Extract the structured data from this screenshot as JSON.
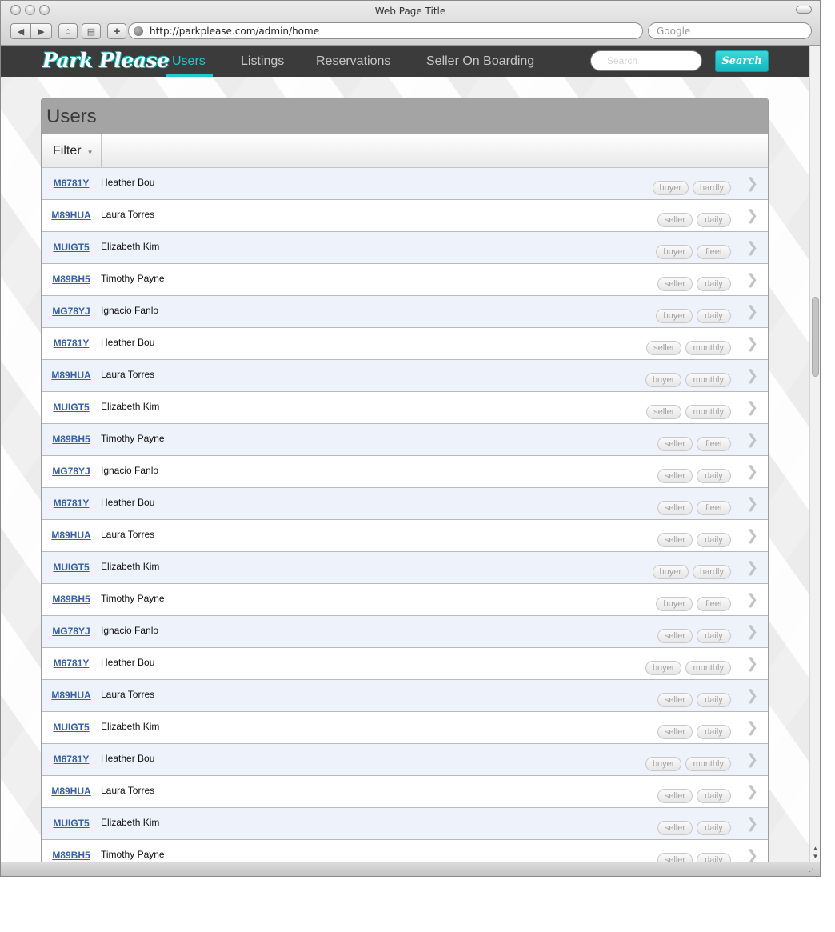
{
  "window": {
    "title": "Web Page Title"
  },
  "browser": {
    "url": "http://parkplease.com/admin/home",
    "search_placeholder": "Google"
  },
  "app": {
    "logo": "Park Please",
    "nav": [
      "Users",
      "Listings",
      "Reservations",
      "Seller On Boarding"
    ],
    "active_nav": "Users",
    "search_placeholder": "Search",
    "search_button": "Search"
  },
  "page": {
    "title": "Users",
    "filter_label": "Filter"
  },
  "users": [
    {
      "id": "M6781Y",
      "name": "Heather Bou",
      "role": "buyer",
      "plan": "hardly"
    },
    {
      "id": "M89HUA",
      "name": "Laura Torres",
      "role": "seller",
      "plan": "daily"
    },
    {
      "id": "MUIGT5",
      "name": "Elizabeth Kim",
      "role": "buyer",
      "plan": "fleet"
    },
    {
      "id": "M89BH5",
      "name": "Timothy Payne",
      "role": "seller",
      "plan": "daily"
    },
    {
      "id": "MG78YJ",
      "name": "Ignacio Fanlo",
      "role": "buyer",
      "plan": "daily"
    },
    {
      "id": "M6781Y",
      "name": "Heather Bou",
      "role": "seller",
      "plan": "monthly"
    },
    {
      "id": "M89HUA",
      "name": "Laura Torres",
      "role": "buyer",
      "plan": "monthly"
    },
    {
      "id": "MUIGT5",
      "name": "Elizabeth Kim",
      "role": "seller",
      "plan": "monthly"
    },
    {
      "id": "M89BH5",
      "name": "Timothy Payne",
      "role": "seller",
      "plan": "fleet"
    },
    {
      "id": "MG78YJ",
      "name": "Ignacio Fanlo",
      "role": "seller",
      "plan": "daily"
    },
    {
      "id": "M6781Y",
      "name": "Heather Bou",
      "role": "seller",
      "plan": "fleet"
    },
    {
      "id": "M89HUA",
      "name": "Laura Torres",
      "role": "seller",
      "plan": "daily"
    },
    {
      "id": "MUIGT5",
      "name": "Elizabeth Kim",
      "role": "buyer",
      "plan": "hardly"
    },
    {
      "id": "M89BH5",
      "name": "Timothy Payne",
      "role": "buyer",
      "plan": "fleet"
    },
    {
      "id": "MG78YJ",
      "name": "Ignacio Fanlo",
      "role": "seller",
      "plan": "daily"
    },
    {
      "id": "M6781Y",
      "name": "Heather Bou",
      "role": "buyer",
      "plan": "monthly"
    },
    {
      "id": "M89HUA",
      "name": "Laura Torres",
      "role": "seller",
      "plan": "daily"
    },
    {
      "id": "MUIGT5",
      "name": "Elizabeth Kim",
      "role": "seller",
      "plan": "daily"
    },
    {
      "id": "M6781Y",
      "name": "Heather Bou",
      "role": "buyer",
      "plan": "monthly"
    },
    {
      "id": "M89HUA",
      "name": "Laura Torres",
      "role": "seller",
      "plan": "daily"
    },
    {
      "id": "MUIGT5",
      "name": "Elizabeth Kim",
      "role": "seller",
      "plan": "daily"
    },
    {
      "id": "M89BH5",
      "name": "Timothy Payne",
      "role": "seller",
      "plan": "daily"
    }
  ],
  "icons": {
    "row_action": "chevron-right-icon"
  },
  "colors": {
    "accent": "#22c7d0",
    "nav_bg": "#3b3b3b",
    "link": "#3561a8",
    "row_alt": "#eef2fb"
  }
}
